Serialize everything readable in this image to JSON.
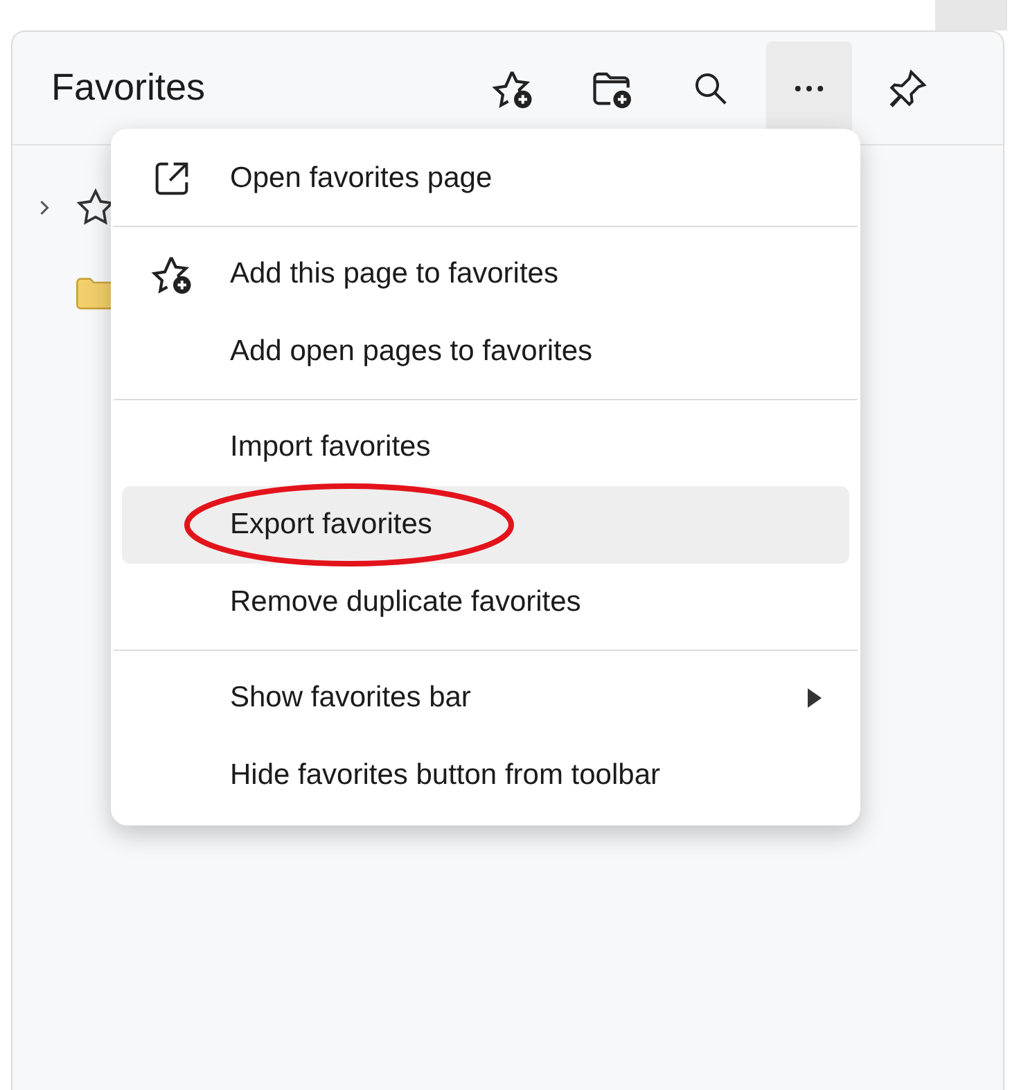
{
  "panel": {
    "title": "Favorites",
    "toolbar": [
      {
        "kind": "star-add",
        "selected": false
      },
      {
        "kind": "folder-add",
        "selected": false
      },
      {
        "kind": "search",
        "selected": false
      },
      {
        "kind": "more",
        "selected": true
      },
      {
        "kind": "pin",
        "selected": false
      }
    ],
    "tree": [
      {
        "kind": "star",
        "expanded": false
      },
      {
        "kind": "folder"
      }
    ]
  },
  "menu": {
    "sections": [
      [
        {
          "label": "Open favorites page",
          "kind": "external-link",
          "highlighted": false,
          "submenu": false
        }
      ],
      [
        {
          "label": "Add this page to favorites",
          "kind": "star-add",
          "highlighted": false,
          "submenu": false
        },
        {
          "label": "Add open pages to favorites",
          "highlighted": false,
          "submenu": false
        }
      ],
      [
        {
          "label": "Import favorites",
          "highlighted": false,
          "submenu": false
        },
        {
          "label": "Export favorites",
          "highlighted": true,
          "submenu": false
        },
        {
          "label": "Remove duplicate favorites",
          "highlighted": false,
          "submenu": false
        }
      ],
      [
        {
          "label": "Show favorites bar",
          "highlighted": false,
          "submenu": true
        },
        {
          "label": "Hide favorites button from toolbar",
          "highlighted": false,
          "submenu": false
        }
      ]
    ]
  },
  "annotation": {
    "kind": "ellipse",
    "color": "#e3131b"
  }
}
